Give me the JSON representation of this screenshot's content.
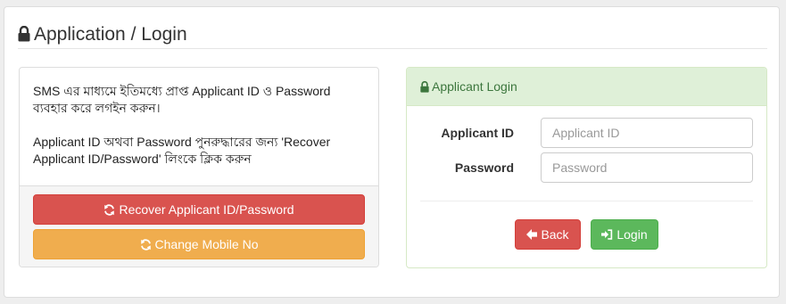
{
  "page": {
    "title": "Application / Login"
  },
  "info": {
    "paragraph1": "SMS এর মাধ্যমে ইতিমধ্যে প্রাপ্ত Applicant ID ও Password ব্যবহার করে লগইন করুন।",
    "paragraph2": "Applicant ID অথবা Password পুনরুদ্ধারের জন্য 'Recover Applicant ID/Password' লিংকে ক্লিক করুন",
    "recover_label": "Recover Applicant ID/Password",
    "change_mobile_label": "Change Mobile No"
  },
  "login": {
    "heading": "Applicant Login",
    "applicant_id_label": "Applicant ID",
    "applicant_id_placeholder": "Applicant ID",
    "password_label": "Password",
    "password_placeholder": "Password",
    "back_label": "Back",
    "login_label": "Login"
  },
  "colors": {
    "danger": "#d9534f",
    "warning": "#f0ad4e",
    "success": "#5cb85c",
    "panel_success_bg": "#dff0d8",
    "panel_success_text": "#3c763d"
  },
  "icons": {
    "title": "lock-icon",
    "recover": "refresh-icon",
    "change_mobile": "refresh-icon",
    "login_heading": "lock-icon",
    "back": "arrow-left-icon",
    "login": "sign-in-icon"
  }
}
